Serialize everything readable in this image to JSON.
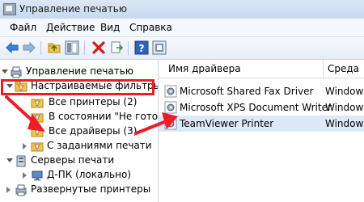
{
  "window": {
    "title": "Управление печатью"
  },
  "menu": [
    "Файл",
    "Действие",
    "Вид",
    "Справка"
  ],
  "toolbar": {
    "buttons": [
      "back-icon",
      "forward-icon",
      "up-folder-icon",
      "show-hide-tree-icon",
      "delete-icon",
      "export-icon",
      "help-icon",
      "properties-icon"
    ]
  },
  "tree": {
    "items": [
      {
        "label": "Управление печатью",
        "expanded": true
      },
      {
        "label": "Настраиваемые фильтры",
        "expanded": true,
        "highlighted": true
      },
      {
        "label": "Все принтеры (2)"
      },
      {
        "label": "В состоянии \"Не готов\""
      },
      {
        "label": "Все драйверы (3)"
      },
      {
        "label": "С заданиями печати"
      },
      {
        "label": "Серверы печати",
        "expanded": true
      },
      {
        "label": "Д-ПК (локально)"
      },
      {
        "label": "Развернутые принтеры"
      }
    ]
  },
  "list": {
    "columns": [
      "Имя драйвера",
      "Среда"
    ],
    "rows": [
      {
        "name": "Microsoft Shared Fax Driver",
        "env": "Windows"
      },
      {
        "name": "Microsoft XPS Document Writer",
        "env": "Windows"
      },
      {
        "name": "TeamViewer Printer",
        "env": "Windows",
        "selected": true
      }
    ]
  },
  "colors": {
    "highlight": "#ee1c25",
    "selection": "#dce9f7"
  }
}
